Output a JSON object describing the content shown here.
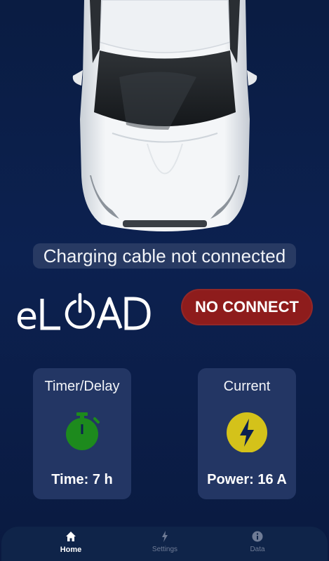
{
  "status": {
    "message": "Charging cable not connected"
  },
  "brand": {
    "logo_text": "eLOAD"
  },
  "connection": {
    "button_label": "NO CONNECT",
    "color": "#8e1c1c"
  },
  "cards": {
    "timer": {
      "title": "Timer/Delay",
      "value": "Time: 7 h",
      "icon": "stopwatch-icon",
      "color": "#1d8a1d"
    },
    "current": {
      "title": "Current",
      "value": "Power: 16 A",
      "icon": "lightning-bolt-icon",
      "color": "#d4c21a"
    }
  },
  "nav": {
    "items": [
      {
        "label": "Home",
        "icon": "home-icon",
        "active": true
      },
      {
        "label": "Settings",
        "icon": "lightning-bolt-icon",
        "active": false
      },
      {
        "label": "Data",
        "icon": "info-icon",
        "active": false
      }
    ]
  }
}
